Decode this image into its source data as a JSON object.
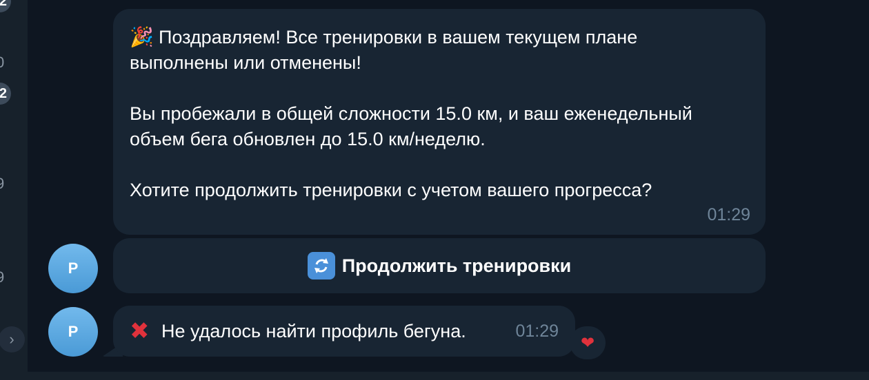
{
  "sidebar": {
    "numbers": [
      "2",
      "0",
      "2",
      "9",
      ".",
      "9",
      "."
    ],
    "scroll_icon": "chevron-right-icon"
  },
  "messages": {
    "congrats": {
      "emoji": "🎉",
      "line1": "Поздравляем! Все тренировки в вашем текущем плане",
      "line2": "выполнены или отменены!",
      "line3": "Вы пробежали в общей сложности 15.0 км, и ваш еженедельный",
      "line4": "объем бега обновлен до 15.0 км/неделю.",
      "line5": "Хотите продолжить тренировки с учетом вашего прогресса?",
      "time": "01:29"
    },
    "keyboard_button": {
      "icon": "refresh-icon",
      "label": "Продолжить тренировки"
    },
    "error": {
      "icon": "cross-mark-icon",
      "text": "Не удалось найти профиль бегуна.",
      "time": "01:29",
      "reaction": "❤"
    },
    "avatar_letter": "P"
  },
  "colors": {
    "background": "#0e1621",
    "bubble": "#182533",
    "accent_avatar": "#5eaae4",
    "time": "#6f8599"
  }
}
